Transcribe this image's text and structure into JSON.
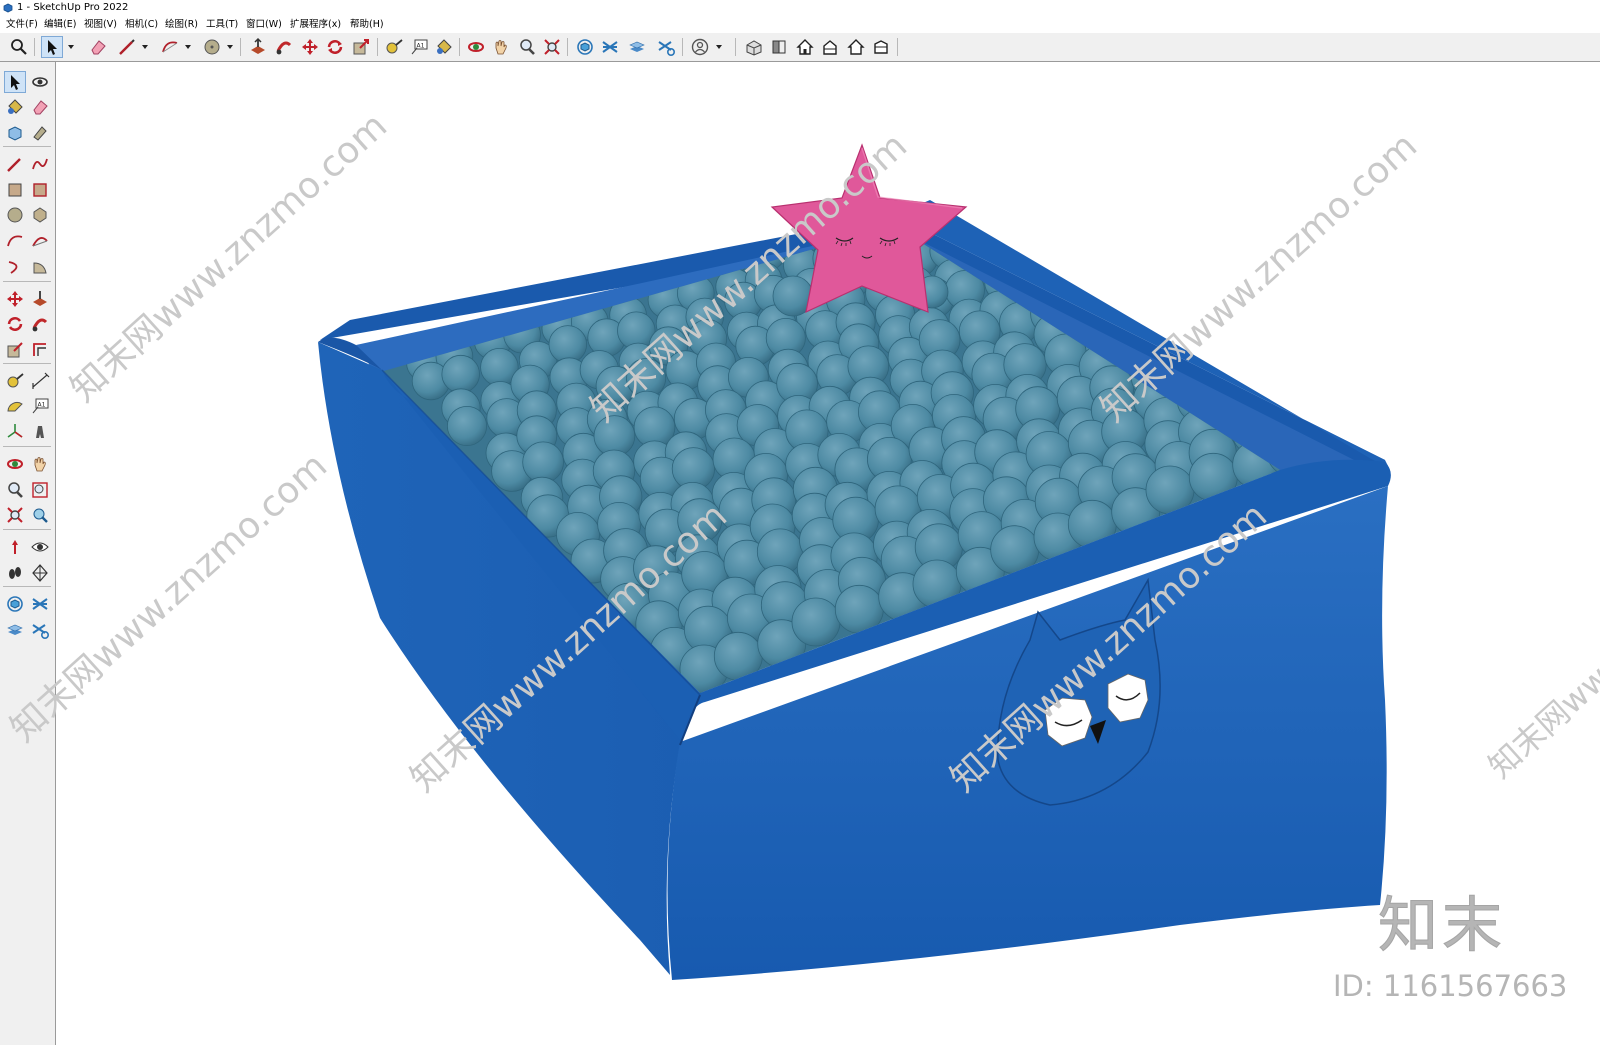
{
  "window": {
    "title": "1 - SketchUp Pro 2022"
  },
  "menu": [
    "文件(F)",
    "编辑(E)",
    "视图(V)",
    "相机(C)",
    "绘图(R)",
    "工具(T)",
    "窗口(W)",
    "扩展程序(x)",
    "帮助(H)"
  ],
  "toolbar": {
    "items": [
      "search-icon",
      "select-icon",
      "eraser-icon",
      "pencil-line-icon",
      "arc-icon",
      "circle-icon",
      "pushpull-icon",
      "follow-me-icon",
      "move-icon",
      "rotate-icon",
      "scale-icon",
      "tape-measure-icon",
      "text-label-icon",
      "paint-bucket-icon",
      "orbit-icon",
      "pan-icon",
      "zoom-icon",
      "zoom-extents-icon",
      "components-icon",
      "scenes-icon",
      "layers-icon",
      "styles-icon",
      "account-icon",
      "warehouse-icon",
      "iso-view-icon",
      "top-view-icon",
      "front-view-icon",
      "right-view-icon",
      "back-view-icon"
    ]
  },
  "left_toolbar": {
    "rows": [
      [
        "select-icon",
        "orbit-icon"
      ],
      [
        "paint-bucket-icon",
        "eraser-icon"
      ],
      [
        "make-component-icon",
        "tag-icon"
      ],
      [
        "line-icon",
        "freehand-icon"
      ],
      [
        "rectangle-icon",
        "rotated-rectangle-icon"
      ],
      [
        "circle-icon",
        "polygon-icon"
      ],
      [
        "arc-icon",
        "two-point-arc-icon"
      ],
      [
        "three-point-arc-icon",
        "pie-icon"
      ],
      [
        "move-icon",
        "pushpull-icon"
      ],
      [
        "rotate-icon",
        "follow-me-icon"
      ],
      [
        "scale-icon",
        "offset-icon"
      ],
      [
        "tape-measure-icon",
        "dimension-icon"
      ],
      [
        "protractor-icon",
        "text-icon"
      ],
      [
        "axes-icon",
        "3d-text-icon"
      ],
      [
        "orbit-tool-icon",
        "pan-tool-icon"
      ],
      [
        "zoom-tool-icon",
        "zoom-window-icon"
      ],
      [
        "zoom-extents-tool-icon",
        "previous-view-icon"
      ],
      [
        "position-camera-icon",
        "look-around-icon"
      ],
      [
        "walk-icon",
        "section-plane-icon"
      ],
      [
        "components-panel-icon",
        "scenes-panel-icon"
      ],
      [
        "layers-panel-icon",
        "styles-panel-icon"
      ]
    ]
  },
  "viewport": {
    "model": "ball pit with star and owl decorations",
    "watermark_text": "知末网www.znzmo.com"
  },
  "brand": {
    "logo_text": "知末",
    "image_id": "ID: 1161567663"
  },
  "colors": {
    "pit_blue": "#1d63b8",
    "ball_teal": "#4d8aa3",
    "star_pink": "#e0589a",
    "owl_blue": "#1f63b5"
  }
}
